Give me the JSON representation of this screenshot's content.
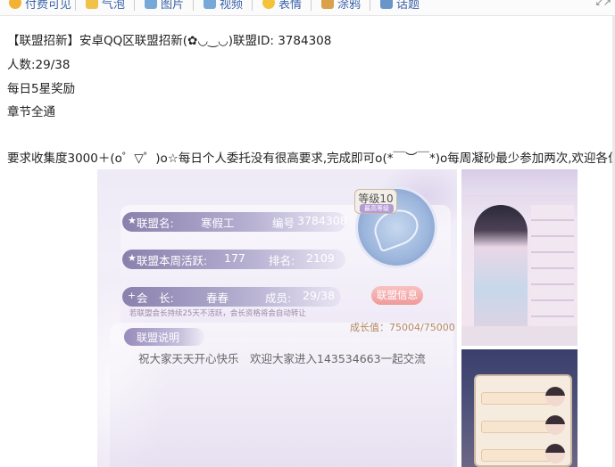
{
  "toolbar": {
    "items": [
      {
        "label": "付费可见",
        "icon": "coin-icon",
        "color": "#f2b233"
      },
      {
        "label": "气泡",
        "icon": "bubble-icon",
        "color": "#f1c24a"
      },
      {
        "label": "图片",
        "icon": "image-icon",
        "color": "#78a8d8"
      },
      {
        "label": "视频",
        "icon": "video-icon",
        "color": "#78a8d8"
      },
      {
        "label": "表情",
        "icon": "emoji-icon",
        "color": "#f3c43a"
      },
      {
        "label": "涂鸦",
        "icon": "brush-icon",
        "color": "#d9a24a"
      },
      {
        "label": "话题",
        "icon": "hash-icon",
        "color": "#6a95c9"
      }
    ],
    "collapse_icon": "collapse-arrows-icon"
  },
  "post": {
    "line1": "【联盟招新】安卓QQ区联盟招新(✿◡‿◡)联盟ID: 3784308",
    "line2": "人数:29/38",
    "line3": "每日5星奖励",
    "line4": "章节全通",
    "line5": "要求收集度3000＋(o゜▽゜)o☆每日个人委托没有很高要求,完成即可o(*￣︶￣*)o每周凝砂最少参加两次,欢迎各位"
  },
  "screenshot": {
    "name_key": "联盟名:",
    "name_val": "寒假工",
    "id_key": "编号",
    "id_val": "3784308",
    "activity_key": "联盟本周活跃:",
    "activity_val": "177",
    "rank_key": "排名:",
    "rank_val": "2109",
    "leader_key": "会　长:",
    "leader_val": "春春",
    "members_key": "成员:",
    "members_val": "29/38",
    "level": "等级10",
    "level_sub": "最高等级",
    "info_button": "联盟信息",
    "notice": "若联盟会长持续25天不活跃，会长资格将会自动转让",
    "growth": "成长值：75004/75000",
    "desc_title": "联盟说明",
    "desc_text": "祝大家天天开心快乐　欢迎大家进入143534663一起交流"
  }
}
